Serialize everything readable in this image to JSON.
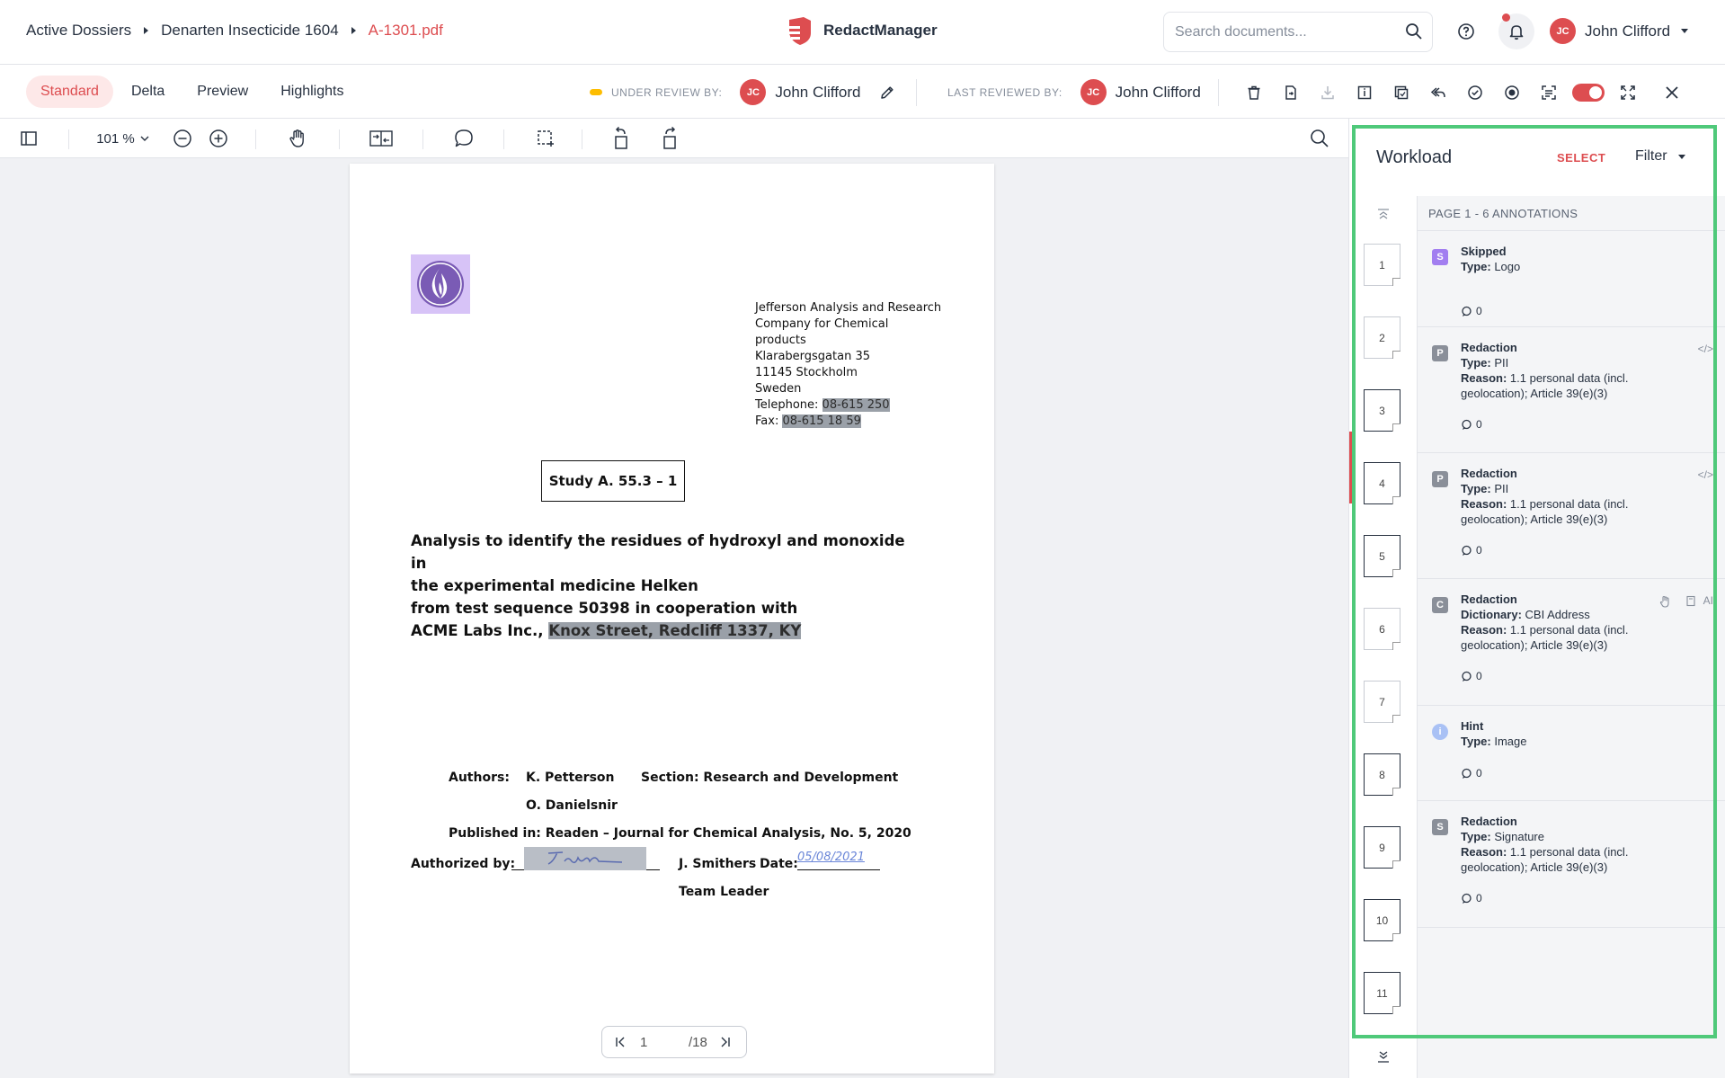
{
  "breadcrumb": [
    {
      "label": "Active Dossiers"
    },
    {
      "label": "Denarten Insecticide 1604"
    },
    {
      "label": "A-1301.pdf"
    }
  ],
  "app": {
    "name": "RedactManager"
  },
  "search": {
    "placeholder": "Search documents..."
  },
  "user": {
    "initials": "JC",
    "name": "John Clifford"
  },
  "modes": [
    {
      "label": "Standard"
    },
    {
      "label": "Delta"
    },
    {
      "label": "Preview"
    },
    {
      "label": "Highlights"
    }
  ],
  "review": {
    "under_label": "UNDER REVIEW BY:",
    "under_name": "John Clifford",
    "last_label": "LAST REVIEWED BY:",
    "last_name": "John Clifford"
  },
  "viewer": {
    "zoom": "101 %"
  },
  "document": {
    "address": [
      "Jefferson Analysis and Research",
      "Company for Chemical",
      "products",
      "Klarabergsgatan 35",
      "11145 Stockholm",
      "Sweden"
    ],
    "telephone_label": "Telephone: ",
    "telephone": "08-615 250",
    "fax_label": "Fax: ",
    "fax": "08-615 18 59",
    "study": "Study A. 55.3 – 1",
    "title_lines": [
      "Analysis to identify the residues of hydroxyl and monoxide in",
      "the experimental medicine Helken",
      "from test sequence 50398 in cooperation with"
    ],
    "title_last_prefix": "ACME Labs Inc., ",
    "title_last_redacted": "Knox Street, Redcliff 1337, KY",
    "authors_label": "Authors:",
    "author1": "K. Petterson",
    "author2": "O. Danielsnir",
    "section": "Section: Research and Development",
    "published": "Published in: Readen – Journal for Chemical Analysis, No. 5, 2020",
    "authorized_label": "Authorized by:",
    "signer": "J. Smithers",
    "date_label": "Date:",
    "date_value": "05/08/2021",
    "signer_role": "Team Leader",
    "signature_text": "J. Smiler"
  },
  "pager": {
    "current": "1",
    "total": "/18"
  },
  "workload": {
    "title": "Workload",
    "select": "SELECT",
    "filter": "Filter",
    "page_header": "PAGE 1 - 6 ANNOTATIONS",
    "pages": [
      "1",
      "2",
      "3",
      "4",
      "5",
      "6",
      "7",
      "8",
      "9",
      "10",
      "11"
    ],
    "annotations": [
      {
        "badge": "S",
        "color": "#a27ef0",
        "title": "Skipped",
        "k1": "Type:",
        "v1": " Logo",
        "k2": "",
        "v2": "",
        "comments": "0",
        "tools": ""
      },
      {
        "badge": "P",
        "color": "#8a8f99",
        "title": "Redaction",
        "k1": "Type:",
        "v1": " PII",
        "k2": "Reason:",
        "v2": " 1.1 personal data (incl. geolocation); Article 39(e)(3)",
        "comments": "0",
        "tools": "</>"
      },
      {
        "badge": "P",
        "color": "#8a8f99",
        "title": "Redaction",
        "k1": "Type:",
        "v1": " PII",
        "k2": "Reason:",
        "v2": " 1.1 personal data (incl. geolocation); Article 39(e)(3)",
        "comments": "0",
        "tools": "</>"
      },
      {
        "badge": "C",
        "color": "#8a8f99",
        "title": "Redaction",
        "k1": "Dictionary:",
        "v1": " CBI Address",
        "k2": "Reason:",
        "v2": " 1.1 personal data (incl. geolocation); Article 39(e)(3)",
        "comments": "0",
        "tools": "AI"
      },
      {
        "badge": "i",
        "color": "#a9c1f5",
        "title": "Hint",
        "k1": "Type:",
        "v1": " Image",
        "k2": "",
        "v2": "",
        "comments": "0",
        "tools": ""
      },
      {
        "badge": "S",
        "color": "#8a8f99",
        "title": "Redaction",
        "k1": "Type:",
        "v1": " Signature",
        "k2": "Reason:",
        "v2": " 1.1 personal data (incl. geolocation); Article 39(e)(3)",
        "comments": "0",
        "tools": ""
      }
    ]
  },
  "colors": {
    "accent": "#dd4d50",
    "highlight": "#4fc97a",
    "redaction": "#9aa0a8"
  }
}
